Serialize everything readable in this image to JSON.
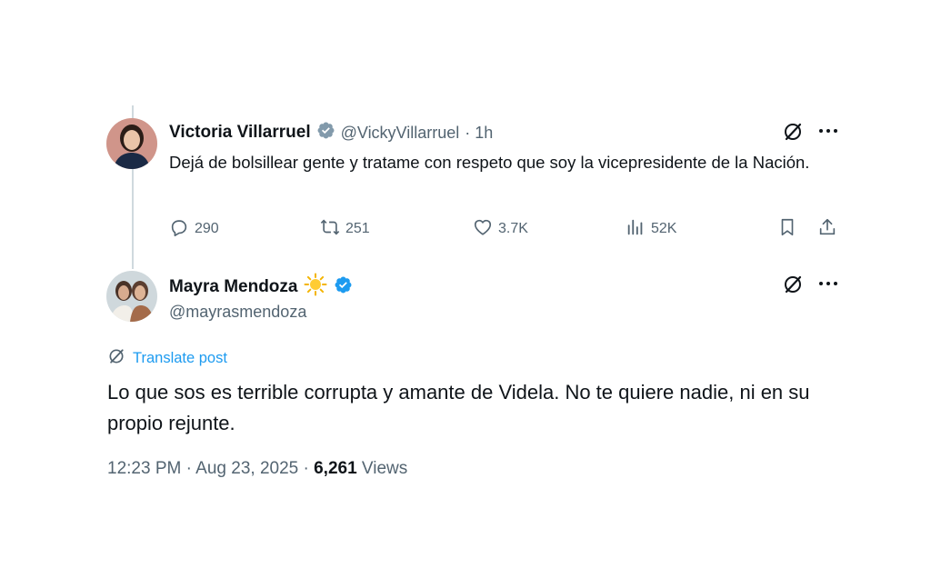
{
  "tweet1": {
    "name": "Victoria Villarruel",
    "handle": "@VickyVillarruel",
    "time": "· 1h",
    "text": "Dejá de bolsillear gente y tratame con respeto que soy la vicepresidente de la Nación.",
    "actions": {
      "replies": "290",
      "reposts": "251",
      "likes": "3.7K",
      "views": "52K"
    }
  },
  "tweet2": {
    "name": "Mayra Mendoza",
    "emoji": "☀️",
    "handle": "@mayrasmendoza",
    "translate": "Translate post",
    "text": "Lo que sos es terrible corrupta y amante de Videla. No te quiere nadie, ni en su propio rejunte.",
    "timestamp": "12:23 PM · Aug 23, 2025 · ",
    "views_count": "6,261",
    "views_label": "Views"
  },
  "colors": {
    "verified_gray": "#829aab",
    "verified_blue": "#1d9bf0",
    "link": "#1d9bf0",
    "secondary_text": "#536471"
  },
  "icons": [
    "grok-icon",
    "more-icon",
    "reply-icon",
    "repost-icon",
    "like-icon",
    "views-icon",
    "bookmark-icon",
    "share-icon",
    "translate-icon",
    "verified-badge-icon",
    "sun-emoji-icon"
  ]
}
